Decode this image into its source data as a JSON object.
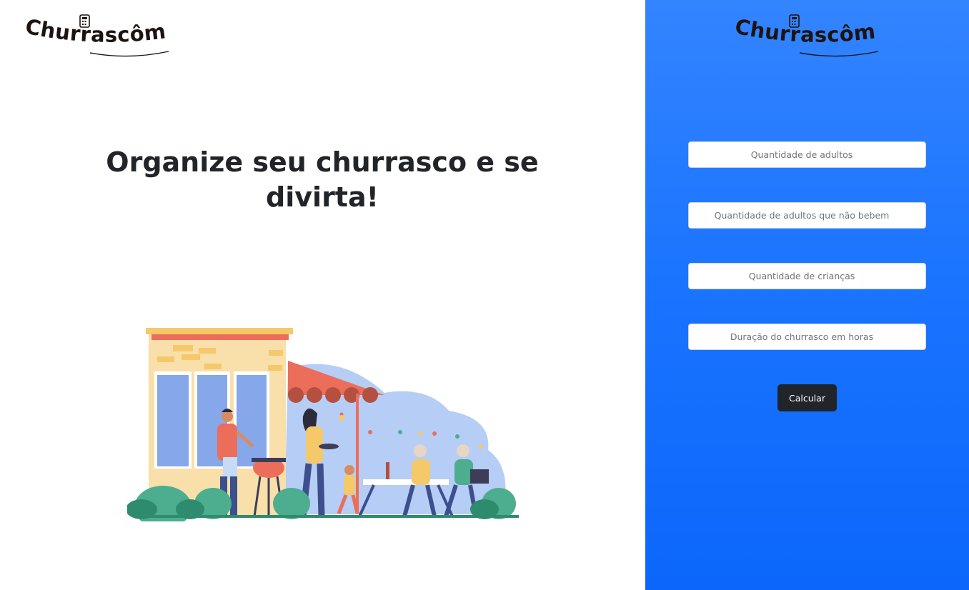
{
  "brand": {
    "name": "Churrascômetro"
  },
  "hero": {
    "headline": "Organize seu churrasco e se divirta!"
  },
  "form": {
    "adults_placeholder": "Quantidade de adultos",
    "non_drinkers_placeholder": "Quantidade de adultos que não bebem",
    "children_placeholder": "Quantidade de crianças",
    "duration_placeholder": "Duração do churrasco em horas",
    "submit_label": "Calcular"
  },
  "colors": {
    "panel_gradient_top": "#3384ff",
    "panel_gradient_bottom": "#0b66fb",
    "button_bg": "#212529",
    "logo_text": "#1d1410"
  }
}
